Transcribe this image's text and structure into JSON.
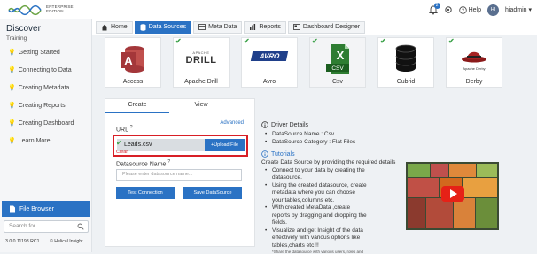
{
  "app": {
    "logo_line1": "ENTERPRISE",
    "logo_line2": "EDITION"
  },
  "topbar": {
    "notification_count": "2",
    "help_label": "Help",
    "avatar_initials": "HI",
    "user_name": "hiadmin"
  },
  "sidebar": {
    "title": "Discover",
    "subtitle": "Training",
    "items": [
      {
        "label": "Getting Started"
      },
      {
        "label": "Connecting to Data"
      },
      {
        "label": "Creating Metadata"
      },
      {
        "label": "Creating Reports"
      },
      {
        "label": "Creating Dashboard"
      },
      {
        "label": "Learn More"
      }
    ],
    "file_browser_label": "File Browser",
    "search_placeholder": "Search for...",
    "version": "3.0.0.11198 RC1",
    "company": "© Helical Insight"
  },
  "breadcrumb": [
    {
      "label": "Home"
    },
    {
      "label": "Data Sources"
    },
    {
      "label": "Meta Data"
    },
    {
      "label": "Reports"
    },
    {
      "label": "Dashboard Designer"
    }
  ],
  "datasources": [
    {
      "label": "Access"
    },
    {
      "label": "Apache Drill",
      "logo_line1": "APACHE",
      "logo_line2": "DRILL"
    },
    {
      "label": "Avro",
      "logo": "AVRO"
    },
    {
      "label": "Csv",
      "logo": "CSV"
    },
    {
      "label": "Cubrid"
    },
    {
      "label": "Derby",
      "logo": "Apache Derby"
    }
  ],
  "form": {
    "tab_create": "Create",
    "tab_view": "View",
    "advanced_label": "Advanced",
    "url_label": "URL",
    "file_name": "Leads.csv",
    "upload_label": "Upload File",
    "clear_label": "Clear",
    "datasource_name_label": "Datasource Name",
    "datasource_name_placeholder": "Please enter datasource name...",
    "test_button": "Test Connection",
    "save_button": "Save DataSource"
  },
  "details": {
    "title": "Driver Details",
    "items": [
      "DataSource Name : Csv",
      "DataSource Category : Flat Files"
    ],
    "tutorials_label": "Tutorials",
    "intro": "Create Data Source by providing the required details",
    "bullets": [
      "Connect to your data by creating the datasource.",
      "Using the created datasource, create metadata where you can choose your tables,columns etc.",
      "With created MetaData ,create reports by dragging and dropping the fields.",
      "Visualize and get Insight of the data effectively with various options like tables,charts etc!!!"
    ],
    "footnote": "*Share the datasource with various users, roles and"
  },
  "colors": {
    "accent": "#2a72c4",
    "highlight": "#d81f26",
    "check": "#3fa34d"
  }
}
